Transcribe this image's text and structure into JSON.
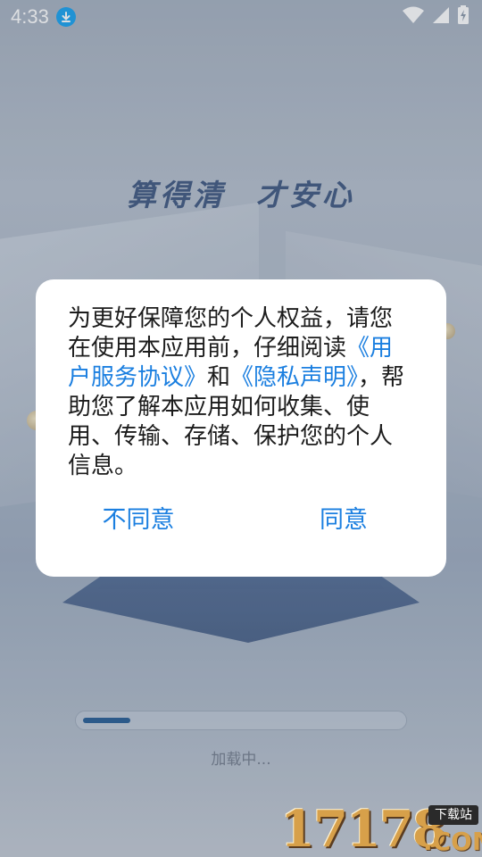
{
  "status_bar": {
    "time": "4:33",
    "icons": [
      "download-icon",
      "wifi-icon",
      "signal-icon",
      "battery-charging-icon"
    ]
  },
  "splash": {
    "slogan": "算得清 才安心"
  },
  "dialog": {
    "text_before": "为更好保障您的个人权益，请您在使用本应用前，仔细阅读",
    "link_user_agreement": "《用户服务协议》",
    "text_and": "和",
    "link_privacy": "《隐私声明》",
    "text_after": "，帮助您了解本应用如何收集、使用、传输、存储、保护您的个人信息。",
    "disagree_label": "不同意",
    "agree_label": "同意"
  },
  "loading": {
    "text": "加载中...",
    "progress": 0.15
  },
  "watermark": {
    "number": "17178",
    "tag": "下载站",
    "domain": ".COM"
  },
  "colors": {
    "link": "#1b7fe0",
    "download_badge": "#1aa3f0",
    "progress_fill": "#2c5a8a"
  }
}
